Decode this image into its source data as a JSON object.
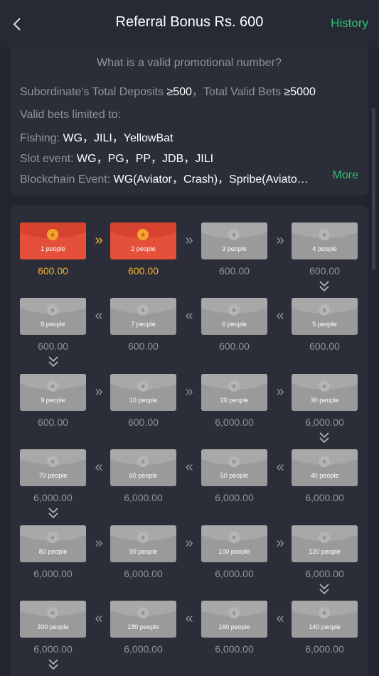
{
  "header": {
    "title": "Referral Bonus Rs. 600",
    "history_label": "History"
  },
  "info": {
    "question": "What is a valid promotional number?",
    "deposits_label": "Subordinate's Total Deposits ",
    "deposits_value": "≥500",
    "bets_label": "，Total Valid Bets ",
    "bets_value": "≥5000",
    "valid_bets_title": "Valid bets limited to:",
    "fishing_label": "Fishing: ",
    "fishing_value": "WG，JILI，YellowBat",
    "slot_label": "Slot event: ",
    "slot_value": "WG，PG，PP，JDB，JILI",
    "blockchain_label": "Blockchain Event: ",
    "blockchain_value": "WG(Aviator，Crash)，Spribe(Aviato…",
    "more_label": "More"
  },
  "tiers": [
    {
      "people": "1 people",
      "amount": "600.00",
      "active": true
    },
    {
      "people": "2 people",
      "amount": "600.00",
      "active": true
    },
    {
      "people": "3 people",
      "amount": "600.00",
      "active": false
    },
    {
      "people": "4 people",
      "amount": "600.00",
      "active": false
    },
    {
      "people": "5 people",
      "amount": "600.00",
      "active": false
    },
    {
      "people": "6 people",
      "amount": "600.00",
      "active": false
    },
    {
      "people": "7 people",
      "amount": "600.00",
      "active": false
    },
    {
      "people": "8 people",
      "amount": "600.00",
      "active": false
    },
    {
      "people": "9 people",
      "amount": "600.00",
      "active": false
    },
    {
      "people": "10 people",
      "amount": "600.00",
      "active": false
    },
    {
      "people": "20 people",
      "amount": "6,000.00",
      "active": false
    },
    {
      "people": "30 people",
      "amount": "6,000.00",
      "active": false
    },
    {
      "people": "40 people",
      "amount": "6,000.00",
      "active": false
    },
    {
      "people": "50 people",
      "amount": "6,000.00",
      "active": false
    },
    {
      "people": "60 people",
      "amount": "6,000.00",
      "active": false
    },
    {
      "people": "70 people",
      "amount": "6,000.00",
      "active": false
    },
    {
      "people": "80 people",
      "amount": "6,000.00",
      "active": false
    },
    {
      "people": "90 people",
      "amount": "6,000.00",
      "active": false
    },
    {
      "people": "100 people",
      "amount": "6,000.00",
      "active": false
    },
    {
      "people": "120 people",
      "amount": "6,000.00",
      "active": false
    },
    {
      "people": "140 people",
      "amount": "6,000.00",
      "active": false
    },
    {
      "people": "160 people",
      "amount": "6,000.00",
      "active": false
    },
    {
      "people": "180 people",
      "amount": "6,000.00",
      "active": false
    },
    {
      "people": "200 people",
      "amount": "6,000.00",
      "active": false
    }
  ],
  "colors": {
    "accent_green": "#31c26b",
    "active_red": "#e5503a",
    "gold": "#f2b32c"
  }
}
